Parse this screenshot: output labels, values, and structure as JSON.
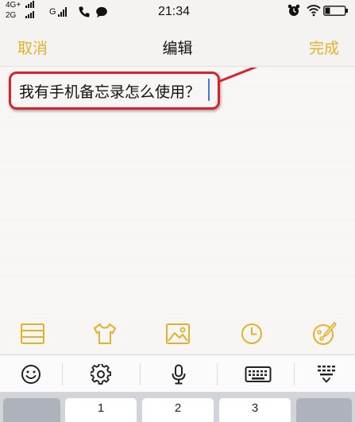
{
  "status_bar": {
    "network_1": "4G+",
    "network_2": "2G",
    "network_3": "G",
    "time": "21:34",
    "icons": [
      "signal-icon",
      "phone-icon",
      "message-icon",
      "alarm-icon",
      "wifi-icon",
      "battery-icon"
    ]
  },
  "nav": {
    "cancel_label": "取消",
    "title": "编辑",
    "done_label": "完成"
  },
  "note": {
    "text": "我有手机备忘录怎么使用？"
  },
  "annotation": {
    "color": "#d9232b"
  },
  "format_toolbar": {
    "icons": [
      "table-icon",
      "shirt-icon",
      "image-icon",
      "clock-icon",
      "palette-icon"
    ]
  },
  "keyboard_toolbar": {
    "icons": [
      "emoji-icon",
      "settings-icon",
      "microphone-icon",
      "keyboard-icon",
      "collapse-keyboard-icon"
    ]
  },
  "keys": {
    "row": [
      "1",
      "2",
      "3"
    ]
  },
  "colors": {
    "accent": "#e4b12c",
    "caret": "#3b7be0"
  }
}
